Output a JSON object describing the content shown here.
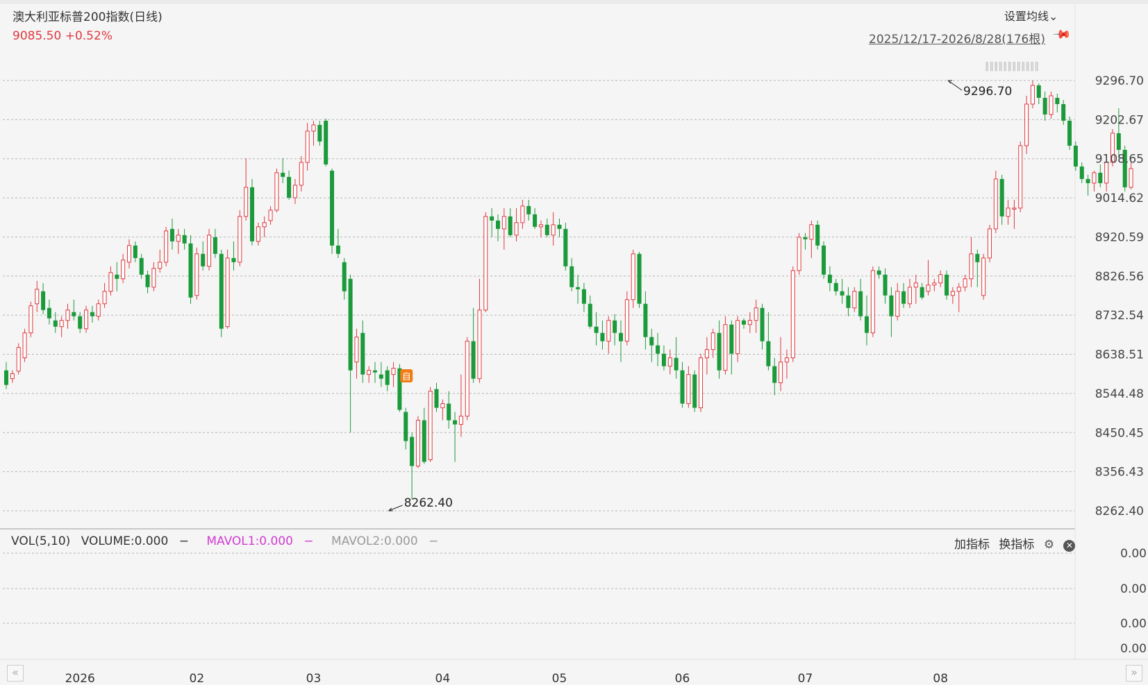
{
  "header": {
    "title": "澳大利亚标普200指数(日线)",
    "price": "9085.50",
    "change": "+0.52%",
    "set_ma_label": "设置均线",
    "set_ma_arrow": "⌄",
    "range_label": "2025/12/17-2026/8/28(176根)",
    "pin_icon": "pin-icon",
    "scroll_indicator": "‖‖‖‖‖‖‖‖‖‖‖‖"
  },
  "volume_panel": {
    "vol_label": "VOL(5,10)",
    "volume_label": "VOLUME:0.000",
    "mavol1_label": "MAVOL1:0.000",
    "mavol2_label": "MAVOL2:0.000",
    "dash": "−",
    "add_indicator_label": "加指标",
    "switch_indicator_label": "换指标",
    "settings_icon": "gear-icon",
    "close_icon": "close-icon",
    "axis_labels": [
      "0.00",
      "0.00",
      "0.00",
      "0.00"
    ]
  },
  "navigation": {
    "left_glyph": "«",
    "right_glyph": "»"
  },
  "colors": {
    "up": "#e0383e",
    "down": "#1a9a3a",
    "grid": "#b5b5b5",
    "mavol1": "#d23ad2"
  },
  "chart_data": {
    "type": "candlestick",
    "title": "澳大利亚标普200指数(日线)",
    "ylim": [
      8262.4,
      9296.7
    ],
    "y_ticks": [
      "9296.70",
      "9202.67",
      "9108.65",
      "9014.62",
      "8920.59",
      "8826.56",
      "8732.54",
      "8638.51",
      "8544.48",
      "8450.45",
      "8356.43",
      "8262.40"
    ],
    "x_ticks": [
      {
        "label": "2026",
        "index": 12
      },
      {
        "label": "02",
        "index": 31
      },
      {
        "label": "03",
        "index": 50
      },
      {
        "label": "04",
        "index": 71
      },
      {
        "label": "05",
        "index": 90
      },
      {
        "label": "06",
        "index": 110
      },
      {
        "label": "07",
        "index": 130
      },
      {
        "label": "08",
        "index": 152
      }
    ],
    "annotations": [
      {
        "text": "9296.70",
        "index": 153,
        "price": 9296.7,
        "type": "max"
      },
      {
        "text": "8262.40",
        "index": 62,
        "price": 8262.4,
        "type": "min"
      }
    ],
    "marker": {
      "text": "自",
      "index": 65
    },
    "ohlc": [
      [
        8600,
        8620,
        8555,
        8565
      ],
      [
        8580,
        8600,
        8570,
        8592
      ],
      [
        8598,
        8665,
        8590,
        8655
      ],
      [
        8630,
        8700,
        8620,
        8690
      ],
      [
        8690,
        8765,
        8680,
        8755
      ],
      [
        8760,
        8815,
        8740,
        8795
      ],
      [
        8790,
        8810,
        8735,
        8745
      ],
      [
        8750,
        8770,
        8710,
        8725
      ],
      [
        8720,
        8740,
        8690,
        8705
      ],
      [
        8705,
        8730,
        8680,
        8720
      ],
      [
        8720,
        8760,
        8700,
        8745
      ],
      [
        8740,
        8770,
        8720,
        8730
      ],
      [
        8730,
        8740,
        8690,
        8700
      ],
      [
        8700,
        8755,
        8690,
        8745
      ],
      [
        8740,
        8755,
        8715,
        8730
      ],
      [
        8730,
        8770,
        8720,
        8760
      ],
      [
        8760,
        8810,
        8750,
        8790
      ],
      [
        8790,
        8850,
        8780,
        8835
      ],
      [
        8830,
        8860,
        8790,
        8820
      ],
      [
        8820,
        8880,
        8810,
        8865
      ],
      [
        8860,
        8915,
        8845,
        8900
      ],
      [
        8900,
        8910,
        8860,
        8870
      ],
      [
        8870,
        8880,
        8820,
        8830
      ],
      [
        8830,
        8840,
        8785,
        8800
      ],
      [
        8800,
        8860,
        8790,
        8845
      ],
      [
        8845,
        8890,
        8835,
        8860
      ],
      [
        8860,
        8945,
        8850,
        8935
      ],
      [
        8940,
        8965,
        8890,
        8910
      ],
      [
        8910,
        8940,
        8880,
        8925
      ],
      [
        8925,
        8940,
        8890,
        8905
      ],
      [
        8905,
        8925,
        8760,
        8775
      ],
      [
        8780,
        8895,
        8770,
        8880
      ],
      [
        8880,
        8910,
        8840,
        8850
      ],
      [
        8850,
        8940,
        8840,
        8925
      ],
      [
        8920,
        8940,
        8870,
        8880
      ],
      [
        8880,
        8890,
        8680,
        8700
      ],
      [
        8705,
        8890,
        8700,
        8870
      ],
      [
        8870,
        8910,
        8840,
        8860
      ],
      [
        8860,
        8985,
        8850,
        8970
      ],
      [
        8970,
        9110,
        8960,
        9040
      ],
      [
        9040,
        9060,
        8900,
        8910
      ],
      [
        8910,
        8955,
        8900,
        8945
      ],
      [
        8945,
        8970,
        8920,
        8955
      ],
      [
        8960,
        8995,
        8950,
        8985
      ],
      [
        8985,
        9085,
        8980,
        9075
      ],
      [
        9075,
        9110,
        9050,
        9065
      ],
      [
        9065,
        9080,
        9010,
        9015
      ],
      [
        9015,
        9060,
        9000,
        9045
      ],
      [
        9045,
        9115,
        9030,
        9100
      ],
      [
        9100,
        9195,
        9080,
        9175
      ],
      [
        9175,
        9200,
        9140,
        9190
      ],
      [
        9190,
        9200,
        9140,
        9150
      ],
      [
        9200,
        9205,
        9090,
        9095
      ],
      [
        9080,
        9085,
        8880,
        8900
      ],
      [
        8900,
        8940,
        8870,
        8880
      ],
      [
        8860,
        8870,
        8770,
        8790
      ],
      [
        8820,
        8830,
        8450,
        8600
      ],
      [
        8620,
        8700,
        8580,
        8680
      ],
      [
        8690,
        8720,
        8570,
        8590
      ],
      [
        8590,
        8610,
        8570,
        8600
      ],
      [
        8600,
        8620,
        8570,
        8595
      ],
      [
        8590,
        8620,
        8560,
        8580
      ],
      [
        8600,
        8610,
        8550,
        8565
      ],
      [
        8590,
        8620,
        8560,
        8605
      ],
      [
        8605,
        8615,
        8500,
        8505
      ],
      [
        8500,
        8510,
        8410,
        8430
      ],
      [
        8440,
        8450,
        8290,
        8370
      ],
      [
        8370,
        8490,
        8365,
        8480
      ],
      [
        8480,
        8510,
        8375,
        8380
      ],
      [
        8385,
        8560,
        8380,
        8550
      ],
      [
        8555,
        8570,
        8500,
        8510
      ],
      [
        8510,
        8530,
        8480,
        8520
      ],
      [
        8520,
        8550,
        8460,
        8480
      ],
      [
        8480,
        8500,
        8380,
        8470
      ],
      [
        8470,
        8590,
        8440,
        8490
      ],
      [
        8490,
        8680,
        8480,
        8670
      ],
      [
        8670,
        8750,
        8570,
        8580
      ],
      [
        8580,
        8820,
        8570,
        8745
      ],
      [
        8745,
        8980,
        8740,
        8970
      ],
      [
        8970,
        8990,
        8920,
        8960
      ],
      [
        8960,
        8975,
        8910,
        8940
      ],
      [
        8940,
        8990,
        8890,
        8970
      ],
      [
        8970,
        8990,
        8920,
        8925
      ],
      [
        8925,
        8990,
        8910,
        8955
      ],
      [
        8955,
        9010,
        8940,
        8995
      ],
      [
        8995,
        9010,
        8960,
        8975
      ],
      [
        8975,
        8990,
        8940,
        8945
      ],
      [
        8945,
        8960,
        8920,
        8950
      ],
      [
        8950,
        8965,
        8920,
        8925
      ],
      [
        8925,
        8980,
        8900,
        8950
      ],
      [
        8950,
        8965,
        8920,
        8940
      ],
      [
        8940,
        8955,
        8840,
        8850
      ],
      [
        8850,
        8870,
        8790,
        8800
      ],
      [
        8800,
        8830,
        8760,
        8795
      ],
      [
        8795,
        8810,
        8740,
        8760
      ],
      [
        8760,
        8780,
        8700,
        8705
      ],
      [
        8705,
        8740,
        8660,
        8690
      ],
      [
        8690,
        8720,
        8650,
        8670
      ],
      [
        8670,
        8730,
        8640,
        8720
      ],
      [
        8720,
        8735,
        8660,
        8690
      ],
      [
        8690,
        8720,
        8620,
        8670
      ],
      [
        8670,
        8790,
        8660,
        8770
      ],
      [
        8770,
        8890,
        8750,
        8880
      ],
      [
        8880,
        8885,
        8750,
        8760
      ],
      [
        8760,
        8790,
        8650,
        8680
      ],
      [
        8680,
        8700,
        8620,
        8660
      ],
      [
        8660,
        8690,
        8610,
        8640
      ],
      [
        8640,
        8660,
        8600,
        8610
      ],
      [
        8610,
        8650,
        8590,
        8630
      ],
      [
        8630,
        8680,
        8580,
        8600
      ],
      [
        8600,
        8620,
        8510,
        8520
      ],
      [
        8520,
        8610,
        8510,
        8590
      ],
      [
        8590,
        8600,
        8500,
        8510
      ],
      [
        8510,
        8640,
        8500,
        8630
      ],
      [
        8630,
        8680,
        8590,
        8650
      ],
      [
        8650,
        8700,
        8630,
        8690
      ],
      [
        8690,
        8720,
        8580,
        8600
      ],
      [
        8600,
        8730,
        8590,
        8710
      ],
      [
        8710,
        8720,
        8590,
        8640
      ],
      [
        8640,
        8730,
        8620,
        8720
      ],
      [
        8720,
        8725,
        8700,
        8710
      ],
      [
        8710,
        8740,
        8690,
        8720
      ],
      [
        8720,
        8770,
        8690,
        8750
      ],
      [
        8750,
        8760,
        8650,
        8670
      ],
      [
        8670,
        8740,
        8600,
        8610
      ],
      [
        8610,
        8630,
        8540,
        8570
      ],
      [
        8570,
        8680,
        8550,
        8620
      ],
      [
        8620,
        8650,
        8580,
        8630
      ],
      [
        8630,
        8850,
        8620,
        8840
      ],
      [
        8840,
        8930,
        8830,
        8920
      ],
      [
        8920,
        8930,
        8890,
        8915
      ],
      [
        8915,
        8960,
        8870,
        8950
      ],
      [
        8950,
        8960,
        8890,
        8900
      ],
      [
        8900,
        8910,
        8820,
        8830
      ],
      [
        8830,
        8850,
        8790,
        8810
      ],
      [
        8810,
        8820,
        8780,
        8790
      ],
      [
        8790,
        8820,
        8760,
        8780
      ],
      [
        8780,
        8800,
        8730,
        8750
      ],
      [
        8750,
        8800,
        8740,
        8790
      ],
      [
        8790,
        8820,
        8720,
        8730
      ],
      [
        8730,
        8780,
        8660,
        8690
      ],
      [
        8690,
        8850,
        8680,
        8840
      ],
      [
        8840,
        8850,
        8820,
        8830
      ],
      [
        8830,
        8845,
        8760,
        8780
      ],
      [
        8780,
        8800,
        8680,
        8730
      ],
      [
        8730,
        8810,
        8720,
        8790
      ],
      [
        8790,
        8810,
        8750,
        8760
      ],
      [
        8760,
        8820,
        8750,
        8800
      ],
      [
        8800,
        8830,
        8760,
        8810
      ],
      [
        8800,
        8810,
        8770,
        8775
      ],
      [
        8790,
        8865,
        8780,
        8805
      ],
      [
        8805,
        8820,
        8790,
        8810
      ],
      [
        8810,
        8840,
        8800,
        8830
      ],
      [
        8830,
        8840,
        8770,
        8780
      ],
      [
        8780,
        8800,
        8760,
        8790
      ],
      [
        8790,
        8810,
        8740,
        8800
      ],
      [
        8800,
        8830,
        8790,
        8820
      ],
      [
        8820,
        8920,
        8800,
        8880
      ],
      [
        8880,
        8890,
        8800,
        8860
      ],
      [
        8780,
        8880,
        8770,
        8870
      ],
      [
        8870,
        8950,
        8860,
        8940
      ],
      [
        8940,
        9080,
        8930,
        9060
      ],
      [
        9060,
        9070,
        8950,
        8970
      ],
      [
        8970,
        9010,
        8950,
        8990
      ],
      [
        8990,
        9010,
        8940,
        8990
      ],
      [
        8990,
        9150,
        8980,
        9140
      ],
      [
        9140,
        9260,
        9120,
        9240
      ],
      [
        9240,
        9297,
        9230,
        9285
      ],
      [
        9285,
        9290,
        9240,
        9255
      ],
      [
        9255,
        9270,
        9200,
        9215
      ],
      [
        9215,
        9270,
        9205,
        9260
      ],
      [
        9255,
        9265,
        9220,
        9240
      ],
      [
        9240,
        9250,
        9190,
        9200
      ],
      [
        9200,
        9210,
        9130,
        9140
      ],
      [
        9140,
        9150,
        9080,
        9090
      ],
      [
        9090,
        9100,
        9050,
        9060
      ],
      [
        9060,
        9070,
        9020,
        9050
      ],
      [
        9050,
        9080,
        9030,
        9075
      ],
      [
        9075,
        9095,
        9040,
        9050
      ],
      [
        9050,
        9100,
        9030,
        9100
      ],
      [
        9100,
        9180,
        9090,
        9170
      ],
      [
        9170,
        9230,
        9110,
        9130
      ],
      [
        9130,
        9140,
        9030,
        9040
      ],
      [
        9040,
        9100,
        9035,
        9085
      ]
    ]
  }
}
